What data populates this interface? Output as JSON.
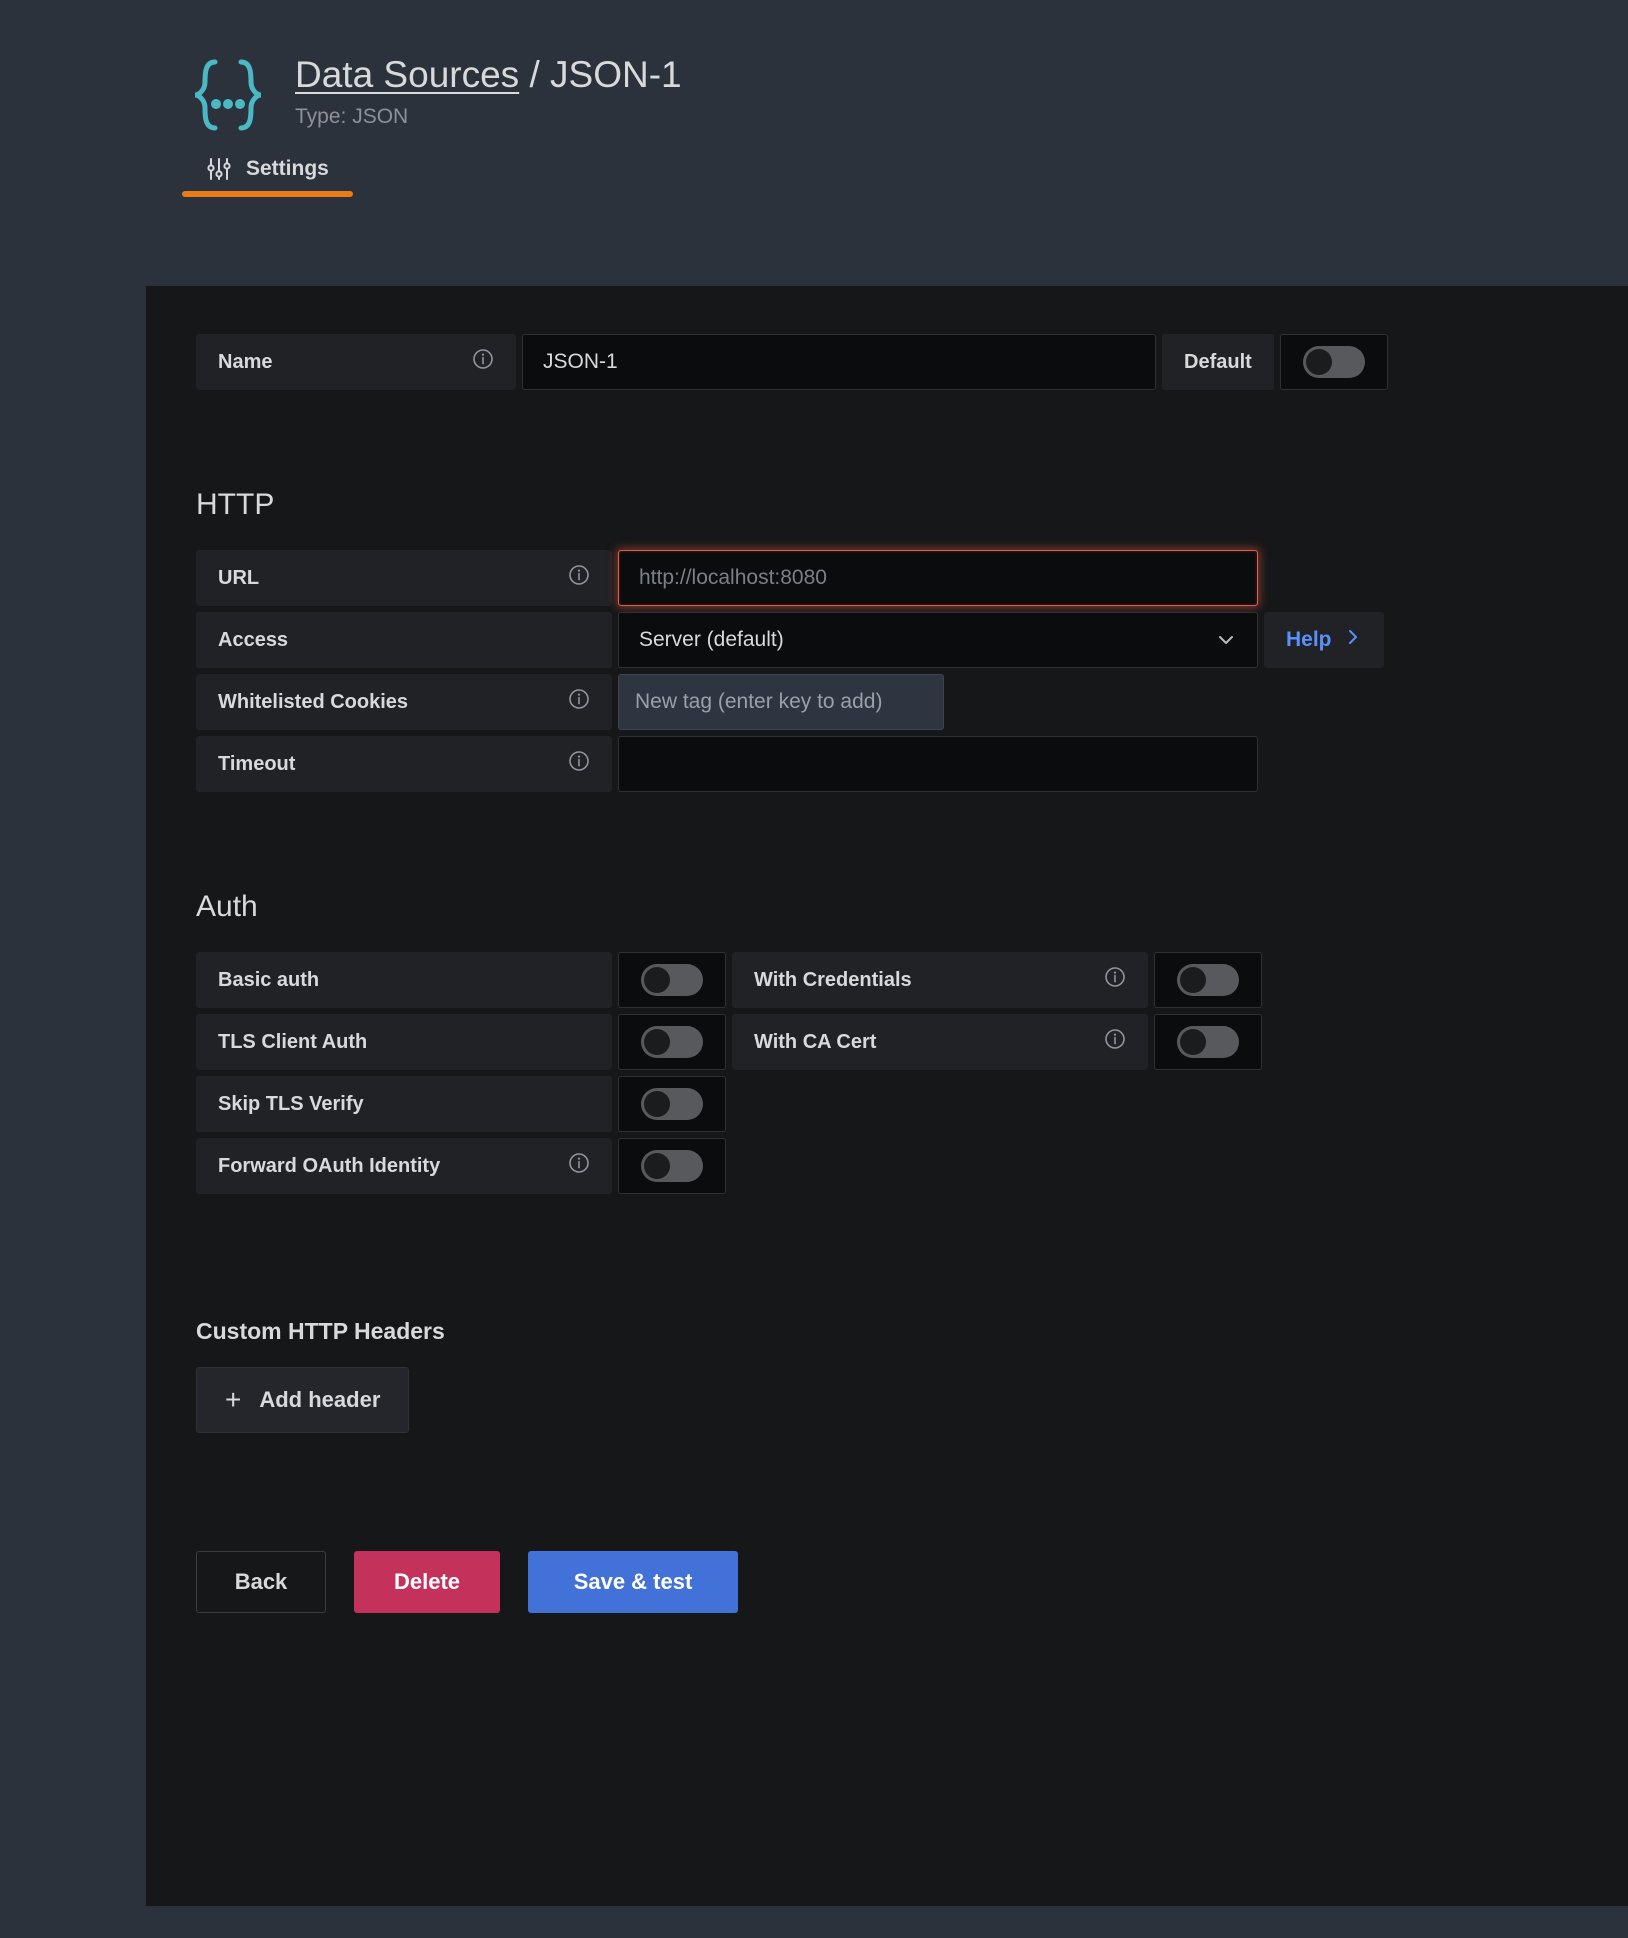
{
  "header": {
    "logo_icon": "json-braces-icon",
    "breadcrumb_root": "Data Sources",
    "breadcrumb_separator": " / ",
    "breadcrumb_current": "JSON-1",
    "subtitle": "Type: JSON"
  },
  "tabs": [
    {
      "label": "Settings",
      "icon": "sliders-icon",
      "active": true
    }
  ],
  "name_row": {
    "label": "Name",
    "info_icon": "info-circle-icon",
    "value": "JSON-1",
    "default_label": "Default",
    "default_toggle": "off"
  },
  "http": {
    "title": "HTTP",
    "url": {
      "label": "URL",
      "info_icon": "info-circle-icon",
      "value": "",
      "placeholder": "http://localhost:8080",
      "state": "error"
    },
    "access": {
      "label": "Access",
      "selected": "Server (default)",
      "chevron_icon": "chevron-down-icon",
      "help_label": "Help",
      "help_icon": "chevron-right-icon"
    },
    "cookies": {
      "label": "Whitelisted Cookies",
      "info_icon": "info-circle-icon",
      "value": "",
      "placeholder": "New tag (enter key to add)"
    },
    "timeout": {
      "label": "Timeout",
      "info_icon": "info-circle-icon",
      "value": "",
      "placeholder": ""
    }
  },
  "auth": {
    "title": "Auth",
    "basic_auth": {
      "label": "Basic auth",
      "toggle": "off"
    },
    "with_credentials": {
      "label": "With Credentials",
      "info_icon": "info-circle-icon",
      "toggle": "off"
    },
    "tls_client_auth": {
      "label": "TLS Client Auth",
      "toggle": "off"
    },
    "with_ca_cert": {
      "label": "With CA Cert",
      "info_icon": "info-circle-icon",
      "toggle": "off"
    },
    "skip_tls_verify": {
      "label": "Skip TLS Verify",
      "toggle": "off"
    },
    "forward_oauth": {
      "label": "Forward OAuth Identity",
      "info_icon": "info-circle-icon",
      "toggle": "off"
    }
  },
  "custom_headers": {
    "title": "Custom HTTP Headers",
    "add_label": "Add header",
    "add_icon": "plus-icon"
  },
  "actions": {
    "back": "Back",
    "delete": "Delete",
    "save": "Save & test"
  },
  "colors": {
    "page_background": "#2c323c",
    "panel_background": "#161719",
    "accent_tab": "#eb7b18",
    "logo": "#4ab9c4",
    "link": "#5b8ff9",
    "delete": "#c4325c",
    "save": "#4272d7",
    "error_border": "#d9614c"
  }
}
